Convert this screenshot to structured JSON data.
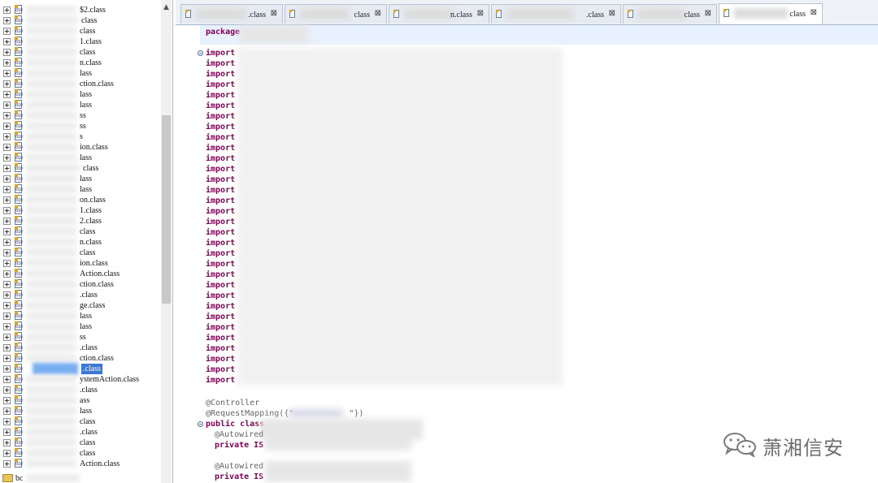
{
  "tree": {
    "items": [
      {
        "label": "$2.class",
        "indent": 98
      },
      {
        "label": "class",
        "indent": 100
      },
      {
        "label": "class",
        "indent": 98
      },
      {
        "label": "1.class",
        "indent": 98
      },
      {
        "label": "class",
        "indent": 98
      },
      {
        "label": "n.class",
        "indent": 98
      },
      {
        "label": "lass",
        "indent": 98
      },
      {
        "label": "ction.class",
        "indent": 98
      },
      {
        "label": "lass",
        "indent": 98
      },
      {
        "label": "lass",
        "indent": 98
      },
      {
        "label": "ss",
        "indent": 98
      },
      {
        "label": "ss",
        "indent": 98
      },
      {
        "label": "s",
        "indent": 98
      },
      {
        "label": "ion.class",
        "indent": 98
      },
      {
        "label": "lass",
        "indent": 98
      },
      {
        "label": "class",
        "indent": 102
      },
      {
        "label": "lass",
        "indent": 98
      },
      {
        "label": "lass",
        "indent": 98
      },
      {
        "label": "on.class",
        "indent": 98
      },
      {
        "label": "1.class",
        "indent": 98
      },
      {
        "label": "2.class",
        "indent": 98
      },
      {
        "label": "class",
        "indent": 98
      },
      {
        "label": "n.class",
        "indent": 98
      },
      {
        "label": "class",
        "indent": 98
      },
      {
        "label": "ion.class",
        "indent": 98
      },
      {
        "label": "Action.class",
        "indent": 98
      },
      {
        "label": "ction.class",
        "indent": 98
      },
      {
        "label": ".class",
        "indent": 98
      },
      {
        "label": "ge.class",
        "indent": 98
      },
      {
        "label": "lass",
        "indent": 98
      },
      {
        "label": "lass",
        "indent": 98
      },
      {
        "label": "ss",
        "indent": 98
      },
      {
        "label": ".class",
        "indent": 98
      },
      {
        "label": "ction.class",
        "indent": 98
      },
      {
        "label": ".class",
        "indent": 100,
        "selected": true
      },
      {
        "label": "ystemAction.class",
        "indent": 98
      },
      {
        "label": ".class",
        "indent": 98
      },
      {
        "label": "ass",
        "indent": 98
      },
      {
        "label": "lass",
        "indent": 98
      },
      {
        "label": "class",
        "indent": 98
      },
      {
        "label": ".class",
        "indent": 98
      },
      {
        "label": "class",
        "indent": 98
      },
      {
        "label": "class",
        "indent": 98
      },
      {
        "label": "Action.class",
        "indent": 98
      }
    ],
    "last_item": {
      "label": "bc"
    }
  },
  "tabs": [
    {
      "label": ".class",
      "close": "⊠"
    },
    {
      "label": "class",
      "close": "⊠"
    },
    {
      "label": "n.class",
      "close": "⊠"
    },
    {
      "label": ".class",
      "close": "⊠"
    },
    {
      "label": "class",
      "close": "⊠"
    },
    {
      "label": "class",
      "close": "⊠",
      "active": true
    }
  ],
  "editor": {
    "package_keyword": "package",
    "import_keyword": "import",
    "import_count": 32,
    "controller_annotation": "@Controller",
    "request_mapping_prefix": "@RequestMapping({\"",
    "request_mapping_suffix": "\"})",
    "public_class": "public class",
    "autowired_1": "@Autowired",
    "private_1": "private IS",
    "autowired_2": "@Autowired",
    "private_2": "private IS"
  },
  "watermark": {
    "text": "萧湘信安",
    "icon": "wechat-icon"
  },
  "colors": {
    "keyword": "#7f0055",
    "annotation": "#646464",
    "selection": "#3b78d6",
    "current_line": "#e8f2fe"
  }
}
